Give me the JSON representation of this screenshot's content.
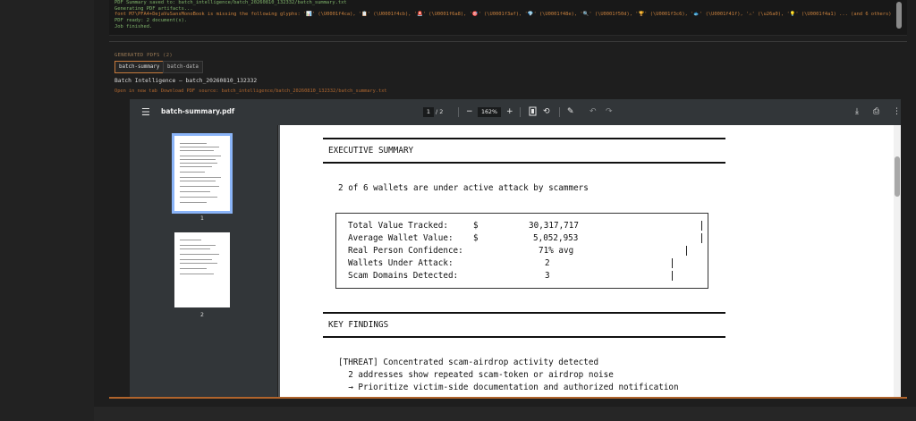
{
  "log": {
    "lines": [
      {
        "text": "PDF Summary saved to: batch_intelligence/batch_20260810_132332/batch_summary.txt",
        "style": "green"
      },
      {
        "text": "Generating PDF artifacts...",
        "style": "green"
      },
      {
        "text": "font M7\\PFA4+DejaVuSansMonoBook is missing the following glyphs: '📊' (\\U0001f4ca), '📋' (\\U0001f4cb), '🚨' (\\U0001f6a8), '🎯' (\\U0001f3af), '💎' (\\U0001f48e), '🔍' (\\U0001f50d), '🏆' (\\U0001f3c6), '🐟' (\\U0001f41f), '⚠' (\\u26a0), '💡' (\\U0001f4a1) ... (and 6 others)",
        "style": "orange"
      },
      {
        "text": "PDF ready: 2 document(s).",
        "style": "green"
      },
      {
        "text": "Job finished.",
        "style": "green"
      }
    ]
  },
  "artifacts": {
    "header": "GENERATED PDFS (2)",
    "tabs": [
      "batch-summary",
      "batch-data"
    ],
    "active_tab": "batch-summary",
    "title": "Batch Intelligence — batch_20260810_132332",
    "links": {
      "open_new_tab": "Open in new tab",
      "download": "Download PDF",
      "source": "source: batch_intelligence/batch_20260810_132332/batch_summary.txt"
    }
  },
  "viewer": {
    "filename": "batch-summary.pdf",
    "current_page": "1",
    "page_total": "/ 2",
    "zoom": "162%",
    "zoom_out": "−",
    "zoom_in": "+",
    "thumbnails": [
      {
        "number": "1",
        "selected": true
      },
      {
        "number": "2",
        "selected": false
      }
    ]
  },
  "page": {
    "exec_header": "EXECUTIVE SUMMARY",
    "exec_line": "2 of 6 wallets are under active attack by scammers",
    "metrics": [
      {
        "label": "Total Value Tracked:",
        "currency": "$",
        "value": "30,317,717"
      },
      {
        "label": "Average Wallet Value:",
        "currency": "$",
        "value": "5,052,953"
      },
      {
        "label": "Real Person Confidence:",
        "currency": "",
        "value": "71% avg"
      },
      {
        "label": "Wallets Under Attack:",
        "currency": "",
        "value": "2"
      },
      {
        "label": "Scam Domains Detected:",
        "currency": "",
        "value": "3"
      }
    ],
    "key_header": "KEY FINDINGS",
    "findings": [
      "[THREAT] Concentrated scam-airdrop activity detected",
      "  2 addresses show repeated scam-token or airdrop noise",
      "  → Prioritize victim-side documentation and authorized notification"
    ]
  }
}
